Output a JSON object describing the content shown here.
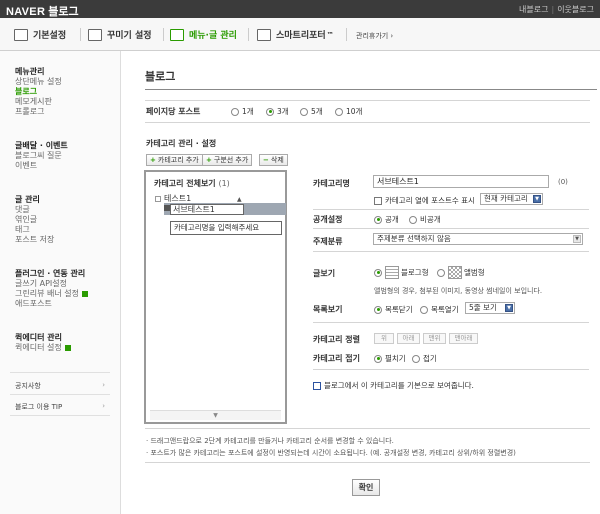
{
  "header": {
    "logo_brand": "NAVER",
    "logo_service": "블로그",
    "links": [
      "내블로그",
      "이웃블로그"
    ]
  },
  "tabs": [
    {
      "label": "기본설정",
      "icon": "settings-list-icon",
      "active": false
    },
    {
      "label": "꾸미기 설정",
      "icon": "decorate-icon",
      "active": false
    },
    {
      "label": "메뉴·글 관리",
      "icon": "menu-post-icon",
      "active": true
    },
    {
      "label": "스마트리포터",
      "icon": "chart-icon",
      "active": false,
      "suffix": "™"
    }
  ],
  "manager_link": "관리휴가기 ›",
  "sidebar": {
    "groups": [
      {
        "title": "메뉴관리",
        "items": [
          {
            "label": "상단메뉴 설정",
            "active": false
          },
          {
            "label": "블로그",
            "active": true
          },
          {
            "label": "메모게시판",
            "active": false
          },
          {
            "label": "프롤로그",
            "active": false
          }
        ]
      },
      {
        "title": "글배달 · 이벤트",
        "items": [
          {
            "label": "블로그씨 질문",
            "active": false
          },
          {
            "label": "이벤트",
            "active": false
          }
        ]
      },
      {
        "title": "글 관리",
        "items": [
          {
            "label": "댓글",
            "active": false
          },
          {
            "label": "엮인글",
            "active": false
          },
          {
            "label": "태그",
            "active": false
          },
          {
            "label": "포스트 저장",
            "active": false
          }
        ]
      },
      {
        "title": "플러그인 · 연동 관리",
        "items": [
          {
            "label": "글쓰기 API설정",
            "active": false
          },
          {
            "label": "그린리뷰 배너 설정",
            "active": false,
            "new": true
          },
          {
            "label": "애드포스트",
            "active": false
          }
        ]
      },
      {
        "title": "퀵에디터 관리",
        "items": [
          {
            "label": "퀵에디터 설정",
            "active": false,
            "new": true
          }
        ]
      }
    ],
    "links": [
      {
        "label": "공지사항",
        "arrow": "›"
      },
      {
        "label": "블로그 이용 TIP",
        "arrow": "›"
      }
    ]
  },
  "main": {
    "title": "블로그",
    "posts_per_page": {
      "label": "페이지당 포스트",
      "options": [
        "1개",
        "3개",
        "5개",
        "10개"
      ],
      "selected": "3개"
    },
    "category_section_title": "카테고리 관리 · 설정",
    "buttons": {
      "add_category": "카테고리 추가",
      "add_divider": "구분선 추가",
      "delete": "삭제"
    },
    "tree": {
      "header": "카테고리 전체보기",
      "count": "(1)",
      "item": "테스트1",
      "editing_value": "서브테스트1",
      "tooltip": "카테고리명을 입력해주세요",
      "scroll_arrow": "▼",
      "caret": "▲"
    },
    "form": {
      "name_label": "카테고리명",
      "name_value": "서브테스트1",
      "name_count": "(0)",
      "show_in_list": "카테고리 열에 포스트수 표시",
      "category_select": "현재 카테고리",
      "visibility_label": "공개설정",
      "visibility_options": [
        "공개",
        "비공개"
      ],
      "visibility_selected": "공개",
      "topic_label": "주제분류",
      "topic_value": "주제분류 선택하지 않음",
      "view_label": "글보기",
      "view_options": [
        "블로그형",
        "앨범형"
      ],
      "view_selected": "블로그형",
      "view_desc": "앨범형의 경우, 첨부된 이미지, 동영상 썸네일이 보입니다.",
      "list_label": "목록보기",
      "list_options": [
        "목록닫기",
        "목록열기"
      ],
      "list_selected": "목록닫기",
      "list_count": "5줄 보기",
      "order_label": "카테고리 정렬",
      "order_buttons": [
        "위",
        "아래",
        "맨위",
        "맨아래"
      ],
      "fold_label": "카테고리 접기",
      "fold_options": [
        "펼치기",
        "접기"
      ],
      "fold_selected": "펼치기",
      "default_open": "블로그에서 이 카테고리를 기본으로 보여줍니다."
    },
    "notes": [
      "· 드래그앤드랍으로 2단계 카테고리를 만들거나 카테고리 순서를 변경할 수 있습니다.",
      "· 포스트가 많은 카테고리는 포스트에 설정이 반영되는데 시간이 소요됩니다. (예. 공개설정 변경, 카테고리 상위/하위 정렬변경)"
    ],
    "ok_button": "확인"
  },
  "colors": {
    "accent": "#2a9b00",
    "topbar": "#3b3b3b",
    "selection": "#9ea7b2"
  }
}
